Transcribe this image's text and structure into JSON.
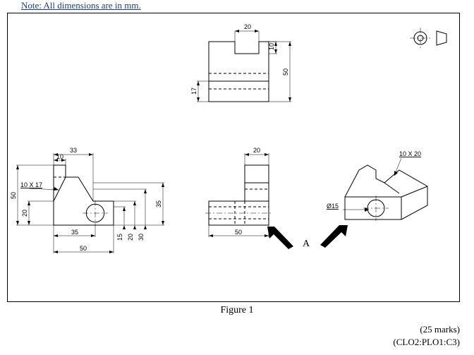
{
  "note_text": "Note: All dimensions are in mm.",
  "caption": "Figure 1",
  "marks": "(25 marks)",
  "outcome": "(CLO2:PLO1:C3)",
  "arrow_label": "A",
  "top_view": {
    "width": "20",
    "notch_depth": "10",
    "height": "50",
    "lower_band": "17"
  },
  "front_view": {
    "notch_w": "33",
    "tab_w": "10",
    "chamfer": "10 X 17",
    "total_h": "50",
    "lower_h": "20",
    "base_x": "35",
    "base_w": "50",
    "base_h": "35",
    "d1": "15",
    "d2": "20",
    "d3": "30"
  },
  "side_view": {
    "tab_w": "20",
    "width": "50"
  },
  "iso_view": {
    "chamfer": "10 X 20",
    "hole_dia": "Ø15"
  }
}
